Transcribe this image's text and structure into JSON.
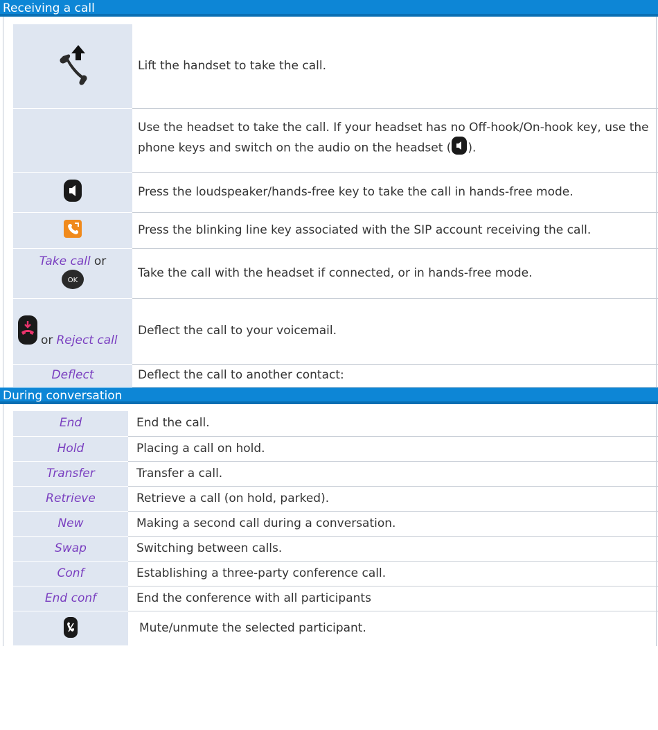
{
  "section1": {
    "title": "Receiving a call",
    "rows": [
      {
        "icon": "lift-handset-icon",
        "text": "Lift the handset to take the call."
      },
      {
        "icon": "",
        "text_before": "Use the headset to take the call. If your headset has no Off-hook/On-hook key, use the phone keys and switch on the audio on the headset (",
        "inline_icon": "loudspeaker-key-icon",
        "text_after": ")."
      },
      {
        "icon": "loudspeaker-key-icon",
        "text": "Press the loudspeaker/hands-free key to take the call in hands-free mode."
      },
      {
        "icon": "line-key-icon",
        "text": "Press the blinking line key associated with the SIP account receiving the call."
      },
      {
        "softkey": "Take call",
        "connector": "or",
        "icon": "ok-key-icon",
        "text": "Take the call with the headset if connected, or in hands-free mode."
      },
      {
        "icon": "hang-up-key-icon",
        "connector": "or",
        "softkey": "Reject call",
        "text": "Deflect the call to your voicemail."
      },
      {
        "softkey": "Deflect",
        "text": "Deflect the call to another contact:"
      }
    ]
  },
  "section2": {
    "title": "During conversation",
    "rows": [
      {
        "softkey": "End",
        "text": "End the call."
      },
      {
        "softkey": "Hold",
        "text": "Placing a call on hold."
      },
      {
        "softkey": "Transfer",
        "text": "Transfer a call."
      },
      {
        "softkey": "Retrieve",
        "text": "Retrieve a call (on hold, parked)."
      },
      {
        "softkey": "New",
        "text": "Making a second call during a conversation."
      },
      {
        "softkey": "Swap",
        "text": "Switching between calls."
      },
      {
        "softkey": "Conf",
        "text": "Establishing a three-party conference call."
      },
      {
        "softkey": "End conf",
        "text": "End the conference with all participants"
      },
      {
        "icon": "mute-key-icon",
        "text": "Mute/unmute the selected participant."
      }
    ]
  },
  "colors": {
    "header_bg": "#0d86d6",
    "key_cell_bg": "#dfe6f1",
    "softkey_text": "#7a3fc0"
  }
}
